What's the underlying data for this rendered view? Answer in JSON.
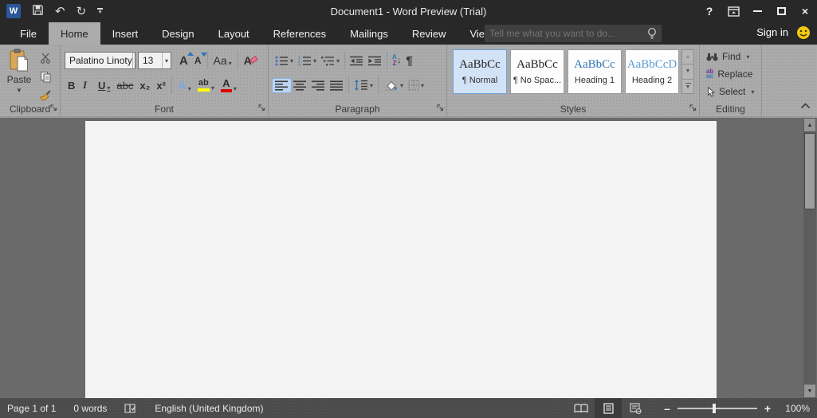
{
  "window": {
    "title": "Document1 - Word Preview (Trial)"
  },
  "icons": {
    "word_logo": "W",
    "undo": "↶",
    "redo": "↻",
    "help": "?",
    "close": "×",
    "scroll_up": "▲",
    "scroll_down": "▼",
    "gallery_up": "▲",
    "gallery_down": "▼",
    "gallery_more": "▼",
    "zoom_out": "–",
    "zoom_in": "+",
    "paste_dropdown": "▼",
    "replace_top": "ab",
    "replace_bottom": "ac"
  },
  "tabs": [
    {
      "label": "File"
    },
    {
      "label": "Home"
    },
    {
      "label": "Insert"
    },
    {
      "label": "Design"
    },
    {
      "label": "Layout"
    },
    {
      "label": "References"
    },
    {
      "label": "Mailings"
    },
    {
      "label": "Review"
    },
    {
      "label": "View"
    }
  ],
  "search": {
    "placeholder": "Tell me what you want to do..."
  },
  "account": {
    "sign_in": "Sign in"
  },
  "ribbon": {
    "clipboard": {
      "label": "Clipboard",
      "paste": "Paste"
    },
    "font": {
      "label": "Font",
      "name": "Palatino Linoty",
      "size": "13",
      "grow": "A",
      "shrink": "A",
      "change_case": "Aa",
      "clear": "A",
      "bold": "B",
      "italic": "I",
      "underline": "U",
      "strike": "abc",
      "subscript": "x₂",
      "superscript": "x²",
      "effects": "A",
      "highlight": "ab",
      "color": "A"
    },
    "paragraph": {
      "label": "Paragraph",
      "sort_a": "A",
      "sort_z": "Z",
      "pilcrow": "¶"
    },
    "styles": {
      "label": "Styles",
      "items": [
        {
          "preview": "AaBbCc",
          "name": "¶ Normal",
          "selected": true
        },
        {
          "preview": "AaBbCc",
          "name": "¶ No Spac...",
          "selected": false
        },
        {
          "preview": "AaBbCc",
          "name": "Heading 1",
          "selected": false
        },
        {
          "preview": "AaBbCcD",
          "name": "Heading 2",
          "selected": false
        }
      ]
    },
    "editing": {
      "label": "Editing",
      "find": "Find",
      "replace": "Replace",
      "select": "Select"
    }
  },
  "status": {
    "page": "Page 1 of 1",
    "words": "0 words",
    "language": "English (United Kingdom)",
    "zoom": "100%"
  },
  "colors": {
    "titlebar": "#282828",
    "ribbon": "#ababab",
    "accent_blue": "#2b579a",
    "heading1_blue": "#2e74b5",
    "heading2_blue": "#5b9bd5",
    "highlight_yellow": "#ffff00",
    "font_color_red": "#e00000",
    "selection_blue": "#bcd4f0"
  }
}
